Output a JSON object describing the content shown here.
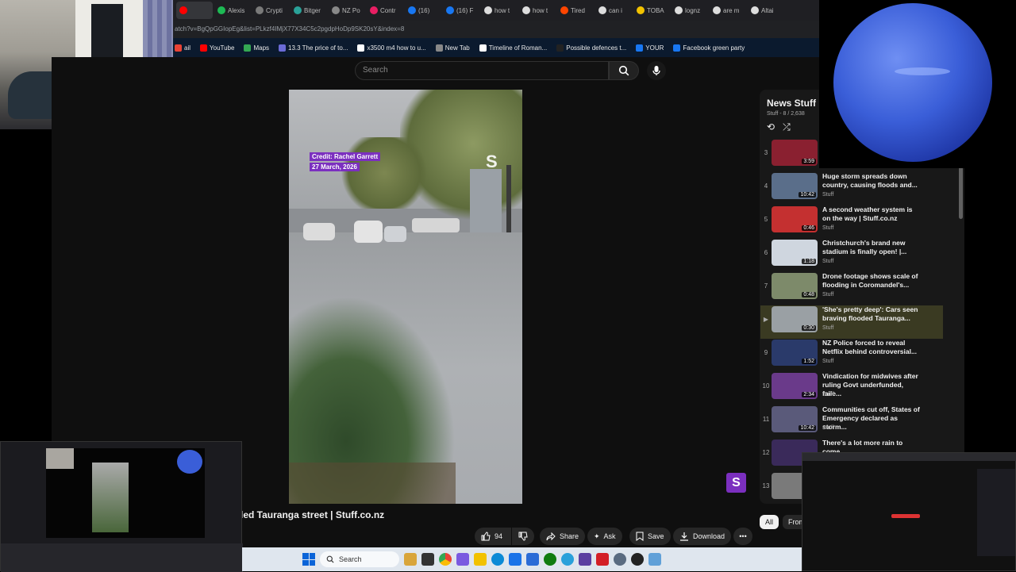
{
  "browser": {
    "tabs": [
      {
        "label": "",
        "color": "#ff0000"
      },
      {
        "label": "Alexis",
        "color": "#1db954"
      },
      {
        "label": "Crypti",
        "color": "#7a7a7a"
      },
      {
        "label": "Bitger",
        "color": "#2aa198"
      },
      {
        "label": "NZ Po",
        "color": "#888888"
      },
      {
        "label": "Contr",
        "color": "#e91e63"
      },
      {
        "label": "(16)",
        "color": "#1877f2"
      },
      {
        "label": "(16) F",
        "color": "#1877f2"
      },
      {
        "label": "how t",
        "color": "#dddddd"
      },
      {
        "label": "how t",
        "color": "#dddddd"
      },
      {
        "label": "Tired",
        "color": "#ff4500"
      },
      {
        "label": "can i",
        "color": "#dddddd"
      },
      {
        "label": "TOBA",
        "color": "#f2c200"
      },
      {
        "label": "lognz",
        "color": "#dddddd"
      },
      {
        "label": "are m",
        "color": "#dddddd"
      },
      {
        "label": "Altai",
        "color": "#dddddd"
      }
    ],
    "url": "atch?v=BgQpGGIopEg&list=PLkzf4IMjX77X34C5c2pgdpHoDp9SK20sY&index=8",
    "bookmarks": [
      {
        "label": "ail",
        "color": "#ea4335"
      },
      {
        "label": "YouTube",
        "color": "#ff0000"
      },
      {
        "label": "Maps",
        "color": "#34a853"
      },
      {
        "label": "13.3 The price of to...",
        "color": "#6b6bd6"
      },
      {
        "label": "x3500 m4 how to u...",
        "color": "#ffffff"
      },
      {
        "label": "New Tab",
        "color": "#888888"
      },
      {
        "label": "Timeline of Roman...",
        "color": "#ffffff"
      },
      {
        "label": "Possible defences t...",
        "color": "#222222"
      },
      {
        "label": "YOUR",
        "color": "#1877f2"
      },
      {
        "label": "Facebook green party",
        "color": "#1877f2"
      }
    ]
  },
  "youtube": {
    "search_placeholder": "Search",
    "video": {
      "credit_line1": "Credit: Rachel Garrett",
      "credit_line2": "27 March, 2026",
      "watermark": "S",
      "title": "led Tauranga street | Stuff.co.nz",
      "likes": "94",
      "share_label": "Share",
      "ask_label": "Ask",
      "save_label": "Save",
      "download_label": "Download"
    },
    "playlist": {
      "title": "News Stuff",
      "meta": "Stuff - 8 / 2,638",
      "items": [
        {
          "index": "3",
          "title": "",
          "channel": "",
          "duration": "3:59",
          "thumb": "#8a2030",
          "active": false
        },
        {
          "index": "4",
          "title": "Huge storm spreads down country, causing floods and...",
          "channel": "Stuff",
          "duration": "10:42",
          "thumb": "#5a6e8a",
          "active": false
        },
        {
          "index": "5",
          "title": "A second weather system is on the way | Stuff.co.nz",
          "channel": "Stuff",
          "duration": "0:46",
          "thumb": "#c43030",
          "active": false
        },
        {
          "index": "6",
          "title": "Christchurch's brand new stadium is finally open! |...",
          "channel": "Stuff",
          "duration": "1:18",
          "thumb": "#cfd6df",
          "active": false
        },
        {
          "index": "7",
          "title": "Drone footage shows scale of flooding in Coromandel's...",
          "channel": "Stuff",
          "duration": "0:48",
          "thumb": "#7d8a6a",
          "active": false
        },
        {
          "index": "",
          "title": "'She's pretty deep': Cars seen braving flooded Tauranga...",
          "channel": "Stuff",
          "duration": "0:30",
          "thumb": "#9aa0a4",
          "active": true
        },
        {
          "index": "9",
          "title": "NZ Police forced to reveal Netflix behind controversial...",
          "channel": "Stuff",
          "duration": "1:52",
          "thumb": "#2a3a6a",
          "active": false
        },
        {
          "index": "10",
          "title": "Vindication for midwives after ruling Govt underfunded, faile...",
          "channel": "Stuff",
          "duration": "2:34",
          "thumb": "#6a3a8a",
          "active": false
        },
        {
          "index": "11",
          "title": "Communities cut off, States of Emergency declared as storm...",
          "channel": "Stuff",
          "duration": "10:42",
          "thumb": "#5a5a7a",
          "active": false
        },
        {
          "index": "12",
          "title": "There's a lot more rain to come,",
          "channel": "",
          "duration": "",
          "thumb": "#3a2a5a",
          "active": false
        },
        {
          "index": "13",
          "title": "",
          "channel": "",
          "duration": "",
          "thumb": "#7a7a7a",
          "active": false
        }
      ]
    },
    "chips": {
      "all": "All",
      "from": "From"
    },
    "stuff_badge": "S"
  },
  "taskbar": {
    "search_label": "Search"
  },
  "colors": {
    "accent": "#7b2fbf",
    "background": "#0f0f0f",
    "active_row": "#3a3a22"
  }
}
